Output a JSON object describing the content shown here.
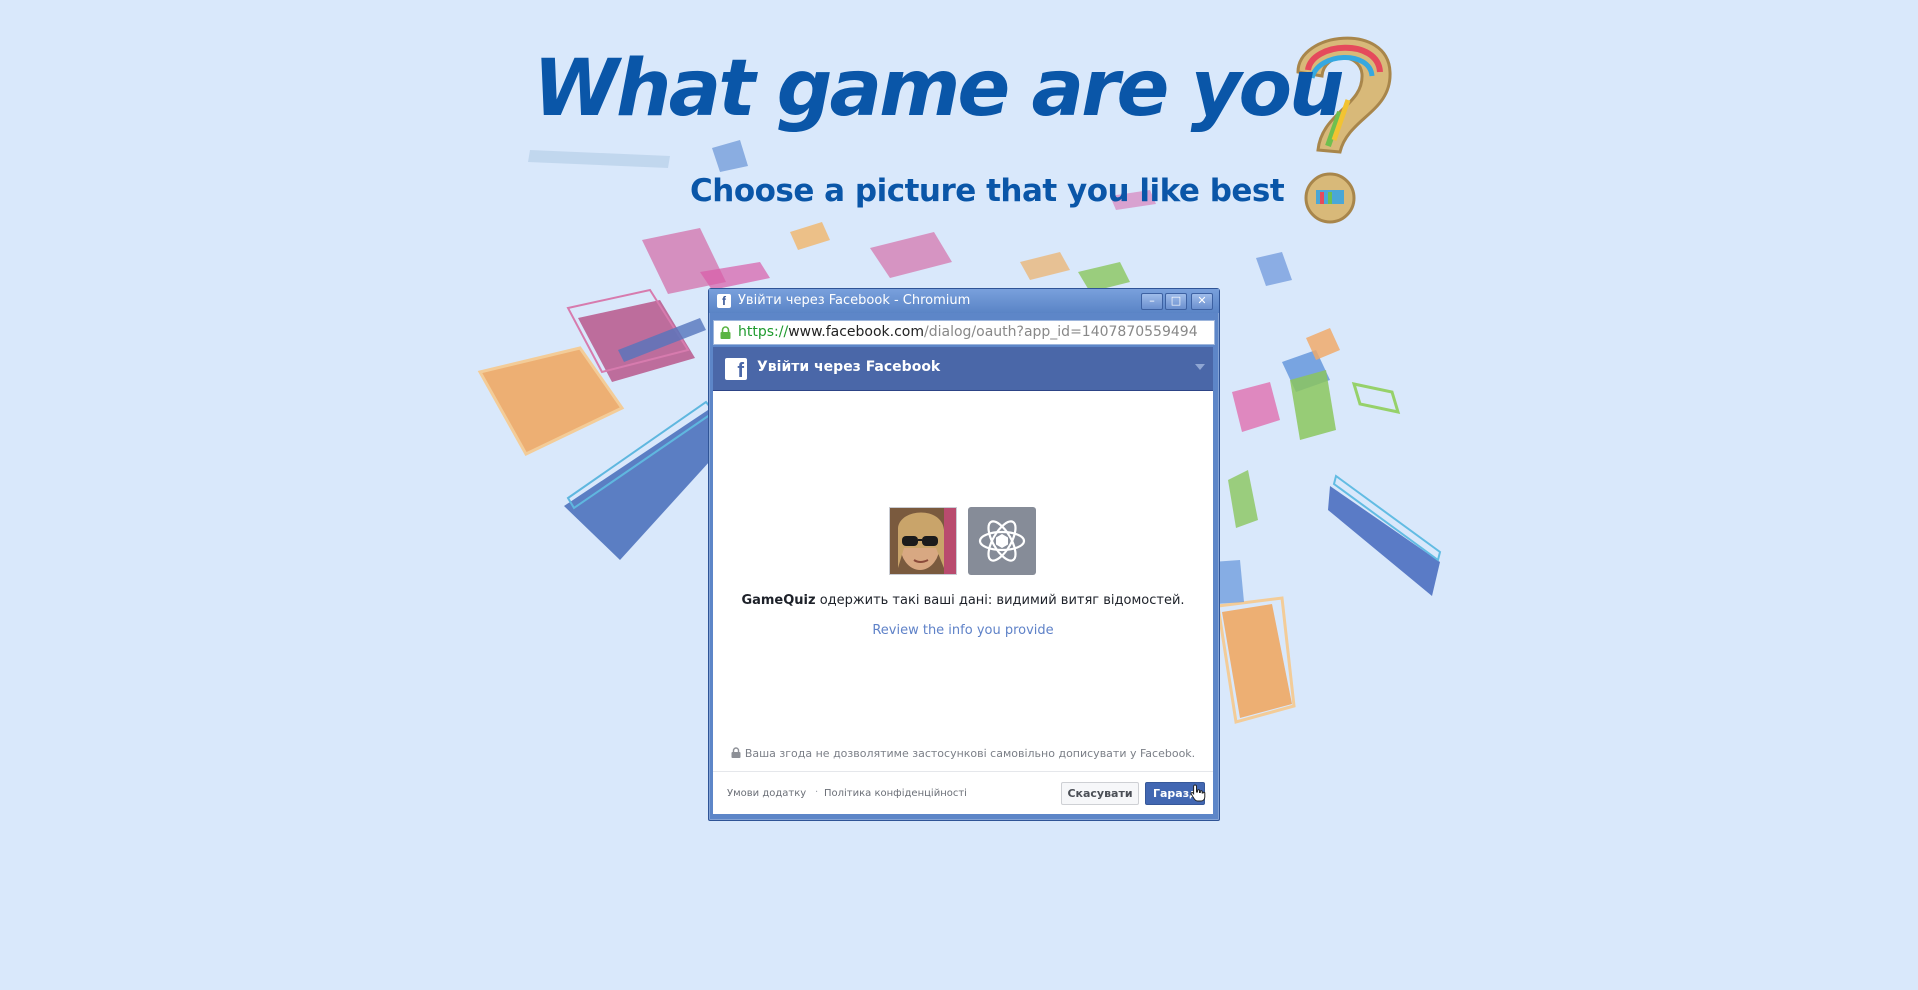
{
  "page": {
    "title": "What game are you",
    "subtitle": "Choose a picture that you like best"
  },
  "window": {
    "title": "Увійти через Facebook - Chromium",
    "fb_icon_letter": "f",
    "controls": {
      "minimize": "–",
      "maximize": "□",
      "close": "✕"
    },
    "address": {
      "scheme": "https://",
      "host": "www.facebook.com",
      "path": "/dialog/oauth?app_id=1407870559494"
    }
  },
  "dialog": {
    "header_title": "Увійти через Facebook",
    "header_logo_letter": "f",
    "app_name": "GameQuiz",
    "permission_text": " одержить такі ваші дані: видимий витяг відомостей.",
    "review_link": "Review the info you provide",
    "notice": "Ваша згода не дозволятиме застосункові самовільно дописувати у Facebook.",
    "footer_links": [
      "Умови додатку",
      "Політика конфіденційності"
    ],
    "footer_separator": "·",
    "cancel_label": "Скасувати",
    "ok_label": "Гаразд"
  },
  "colors": {
    "background": "#d9e8fb",
    "title_blue": "#0a56a8",
    "fb_blue": "#4a67a8",
    "link_blue": "#5f82c8"
  }
}
